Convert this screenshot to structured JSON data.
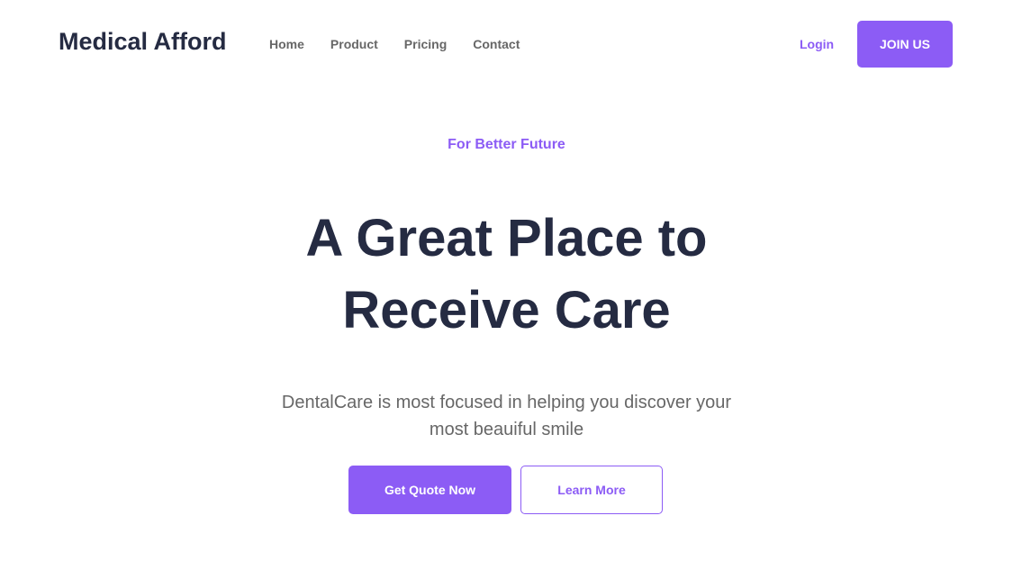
{
  "header": {
    "logo": "Medical Afford",
    "nav": [
      "Home",
      "Product",
      "Pricing",
      "Contact"
    ],
    "login_label": "Login",
    "join_label": "JOIN US"
  },
  "hero": {
    "tagline": "For Better Future",
    "title_line1": "A Great Place to",
    "title_line2": "Receive Care",
    "description": "DentalCare is most focused in helping you discover your most beauiful smile",
    "primary_cta": "Get Quote Now",
    "secondary_cta": "Learn More"
  },
  "colors": {
    "accent": "#8c5cf5",
    "heading": "#252b42",
    "text": "#676767"
  }
}
